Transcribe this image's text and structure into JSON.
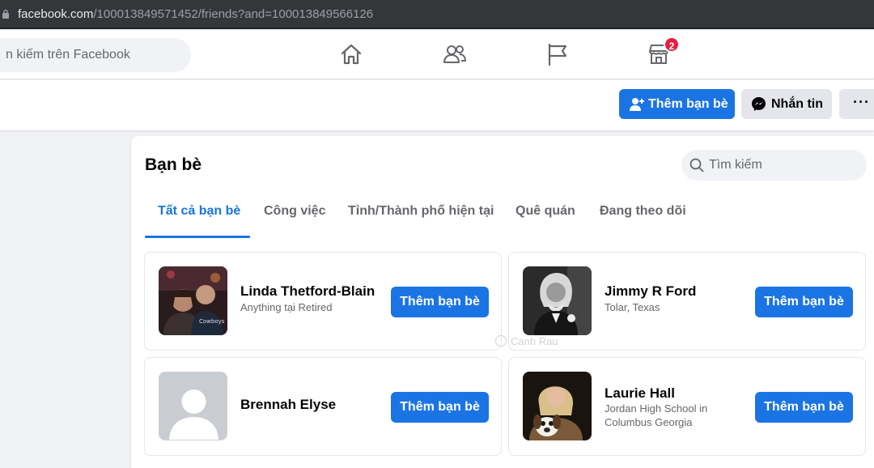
{
  "browser": {
    "url_host": "facebook.com",
    "url_path": "/100013849571452/friends?and=100013849566126"
  },
  "topnav": {
    "search_placeholder": "n kiếm trên Facebook",
    "marketplace_badge": "2"
  },
  "profile_actions": {
    "add_friend_label": "Thêm bạn bè",
    "message_label": "Nhắn tin",
    "more_label": "···"
  },
  "friends": {
    "title": "Bạn bè",
    "search_placeholder": "Tìm kiếm",
    "tabs": [
      {
        "label": "Tất cả bạn bè",
        "active": true
      },
      {
        "label": "Công việc",
        "active": false
      },
      {
        "label": "Tỉnh/Thành phố hiện tại",
        "active": false
      },
      {
        "label": "Quê quán",
        "active": false
      },
      {
        "label": "Đang theo dõi",
        "active": false
      }
    ],
    "list": [
      {
        "name": "Linda Thetford-Blain",
        "subtitle": "Anything tại Retired",
        "button": "Thêm bạn bè"
      },
      {
        "name": "Jimmy R Ford",
        "subtitle": "Tolar, Texas",
        "button": "Thêm bạn bè"
      },
      {
        "name": "Brennah Elyse",
        "subtitle": "",
        "button": "Thêm bạn bè"
      },
      {
        "name": "Laurie Hall",
        "subtitle": "Jordan High School in Columbus Georgia",
        "button": "Thêm bạn bè"
      }
    ]
  },
  "watermark": "Canh Rau",
  "colors": {
    "accent": "#1b74e4",
    "badge": "#e41e3f",
    "background": "#f0f2f5"
  }
}
